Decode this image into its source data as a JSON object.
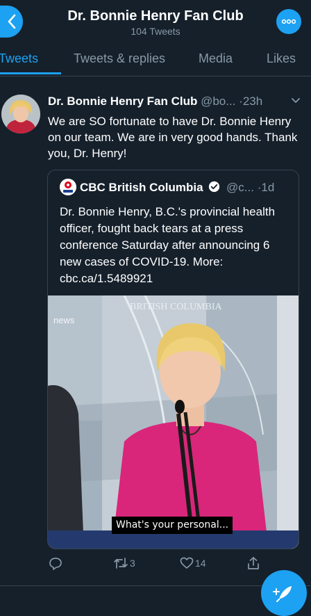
{
  "header": {
    "title": "Dr. Bonnie Henry Fan Club",
    "subtitle": "104 Tweets"
  },
  "tabs": [
    {
      "label": "Tweets",
      "active": true
    },
    {
      "label": "Tweets & replies",
      "active": false
    },
    {
      "label": "Media",
      "active": false
    },
    {
      "label": "Likes",
      "active": false
    }
  ],
  "tweet": {
    "author_name": "Dr. Bonnie Henry Fan Club",
    "author_handle": "@bo...",
    "time": "·23h",
    "text": "We are SO fortunate to have Dr. Bonnie Henry on our team. We are in very good hands. Thank you, Dr. Henry!",
    "quote": {
      "author_name": "CBC British Columbia",
      "author_handle": "@c...",
      "time": "·1d",
      "text": "Dr. Bonnie Henry, B.C.'s provincial health officer, fought back tears at a press conference Saturday after announcing 6 new cases of COVID-19. More: cbc.ca/1.5489921",
      "video": {
        "caption": "What's your personal...",
        "backdrop_text": "BRITISH COLUMBIA",
        "news_logo_text": "news"
      }
    },
    "actions": {
      "replies": "",
      "retweets": "3",
      "likes": "14"
    }
  },
  "icons": {
    "back": "chevron-left-icon",
    "more": "more-dots-icon",
    "reply": "reply-icon",
    "retweet": "retweet-icon",
    "like": "heart-icon",
    "share": "share-icon",
    "compose": "compose-feather-icon",
    "verified": "verified-badge-icon"
  },
  "colors": {
    "background": "#15202b",
    "accent": "#1da1f2",
    "secondary_text": "#8899a6",
    "border": "#38444d"
  }
}
